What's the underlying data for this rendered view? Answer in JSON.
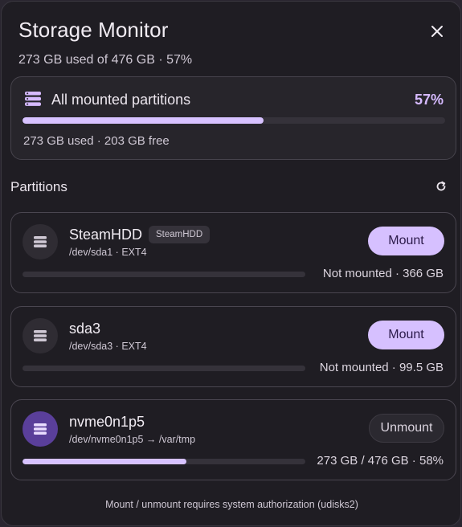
{
  "window": {
    "title": "Storage Monitor",
    "subtitle": "273 GB used of 476 GB · 57%"
  },
  "summary": {
    "label": "All mounted partitions",
    "percent_text": "57%",
    "usage_fraction": 0.57,
    "caption": "273 GB used · 203 GB free"
  },
  "partitions_section": {
    "title": "Partitions"
  },
  "partitions": [
    {
      "name": "SteamHDD",
      "badge": "SteamHDD",
      "device": "/dev/sda1 · EXT4",
      "button": "Mount",
      "status": "Not mounted · 366 GB",
      "usage_fraction": 0,
      "mounted": false
    },
    {
      "name": "sda3",
      "device": "/dev/sda3 · EXT4",
      "button": "Mount",
      "status": "Not mounted · 99.5 GB",
      "usage_fraction": 0,
      "mounted": false
    },
    {
      "name": "nvme0n1p5",
      "device": "/dev/nvme0n1p5 → /var/tmp",
      "button": "Unmount",
      "status": "273 GB / 476 GB · 58%",
      "usage_fraction": 0.58,
      "mounted": true
    }
  ],
  "footer": {
    "text": "Mount / unmount requires system authorization (udisks2)"
  },
  "icons": {
    "close": "close-icon",
    "storage": "storage-icon",
    "refresh": "refresh-icon",
    "drive": "drive-icon"
  },
  "colors": {
    "accent": "#d6c0ff",
    "active_avatar": "#5a3f9a",
    "panel_bg": "#1f1d23"
  }
}
